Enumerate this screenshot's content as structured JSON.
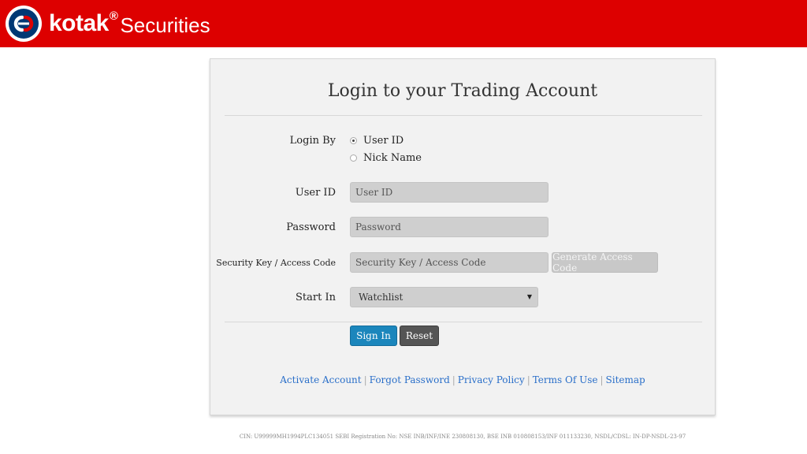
{
  "header": {
    "brand": "kotak",
    "registered_mark": "®",
    "product": "Securities",
    "colors": {
      "background": "#dd0000",
      "logo_blue": "#003874"
    }
  },
  "form": {
    "title": "Login to your Trading Account",
    "login_by": {
      "label": "Login By",
      "options": [
        {
          "label": "User ID",
          "selected": true
        },
        {
          "label": "Nick Name",
          "selected": false
        }
      ]
    },
    "user_id": {
      "label": "User ID",
      "placeholder": "User ID",
      "value": ""
    },
    "password": {
      "label": "Password",
      "placeholder": "Password",
      "value": ""
    },
    "security_key": {
      "label": "Security Key / Access Code",
      "placeholder": "Security Key / Access Code",
      "value": "",
      "generate_label": "Generate Access Code"
    },
    "start_in": {
      "label": "Start In",
      "selected": "Watchlist"
    },
    "buttons": {
      "sign_in": "Sign In",
      "reset": "Reset"
    },
    "colors": {
      "sign_in": "#1b86bc",
      "reset": "#555555",
      "link": "#2a6fc9"
    }
  },
  "links": [
    "Activate Account",
    "Forgot Password",
    "Privacy Policy",
    "Terms Of Use",
    "Sitemap"
  ],
  "link_separator": "|",
  "footer": {
    "text": "CIN: U99999MH1994PLC134051 SEBI Registration No: NSE INB/INF/INE 230808130, BSE INB 010808153/INF 011133230, NSDL/CDSL: IN-DP-NSDL-23-97"
  }
}
